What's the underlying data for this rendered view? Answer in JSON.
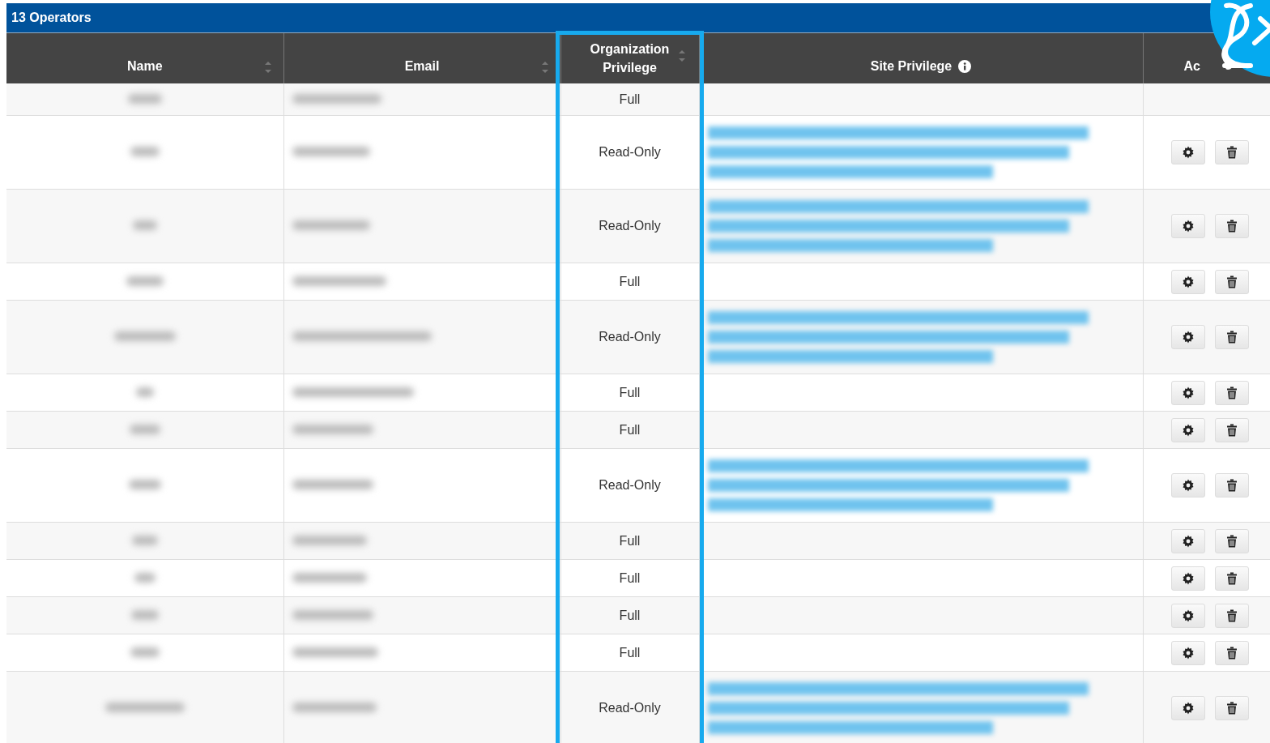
{
  "panel": {
    "title": "13 Operators"
  },
  "columns": [
    {
      "label": "Name",
      "sortable": true,
      "info": false,
      "highlighted": false
    },
    {
      "label": "Email",
      "sortable": true,
      "info": false,
      "highlighted": false
    },
    {
      "label": "Organization Privilege",
      "sortable": true,
      "info": false,
      "highlighted": true
    },
    {
      "label": "Site Privilege",
      "sortable": false,
      "info": true,
      "highlighted": false
    },
    {
      "label": "Ac"
    }
  ],
  "rows": [
    {
      "org_privilege": "Full",
      "site_privilege_blurred": false,
      "actions": false
    },
    {
      "org_privilege": "Read-Only",
      "site_privilege_blurred": true,
      "actions": true
    },
    {
      "org_privilege": "Read-Only",
      "site_privilege_blurred": true,
      "actions": true
    },
    {
      "org_privilege": "Full",
      "site_privilege_blurred": false,
      "actions": true
    },
    {
      "org_privilege": "Read-Only",
      "site_privilege_blurred": true,
      "actions": true
    },
    {
      "org_privilege": "Full",
      "site_privilege_blurred": false,
      "actions": true
    },
    {
      "org_privilege": "Full",
      "site_privilege_blurred": false,
      "actions": true
    },
    {
      "org_privilege": "Read-Only",
      "site_privilege_blurred": true,
      "actions": true
    },
    {
      "org_privilege": "Full",
      "site_privilege_blurred": false,
      "actions": true
    },
    {
      "org_privilege": "Full",
      "site_privilege_blurred": false,
      "actions": true
    },
    {
      "org_privilege": "Full",
      "site_privilege_blurred": false,
      "actions": true
    },
    {
      "org_privilege": "Full",
      "site_privilege_blurred": false,
      "actions": true
    },
    {
      "org_privilege": "Read-Only",
      "site_privilege_blurred": true,
      "actions": true
    }
  ]
}
